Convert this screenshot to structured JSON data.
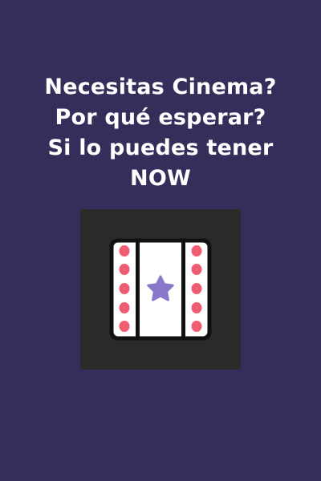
{
  "promo": {
    "headline_lines": [
      "Necesitas Cinema?",
      "Por qué esperar?",
      "Si lo puedes tener",
      "NOW"
    ]
  },
  "icon": {
    "name": "film-strip-star-icon"
  },
  "colors": {
    "background": "#372d5b",
    "text": "#ffffff",
    "icon_tile": "#2a2a2a",
    "film_frame": "#ffffff",
    "film_outline": "#111111",
    "perforation": "#f25c73",
    "star": "#8a78c9"
  }
}
